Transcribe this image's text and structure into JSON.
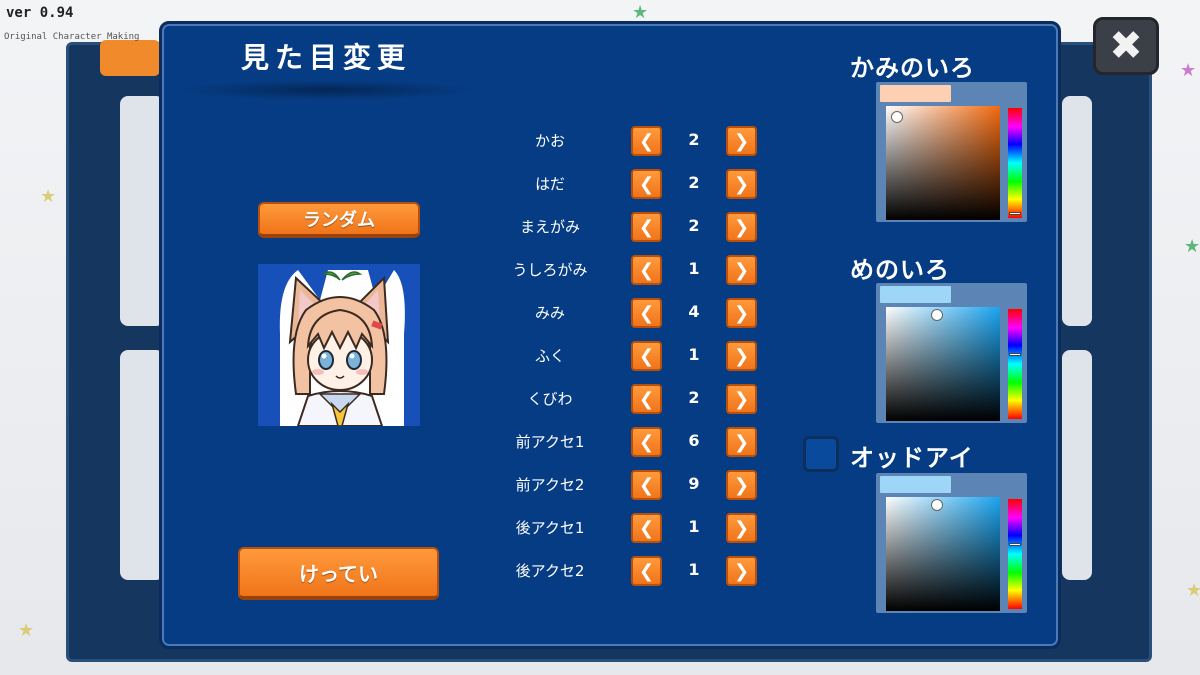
{
  "app": {
    "version": "ver 0.94",
    "subtitle": "Original Character Making"
  },
  "dialog": {
    "title": "見た目変更",
    "random_label": "ランダム",
    "confirm_label": "けってい"
  },
  "parts": [
    {
      "label": "かお",
      "value": "2"
    },
    {
      "label": "はだ",
      "value": "2"
    },
    {
      "label": "まえがみ",
      "value": "2"
    },
    {
      "label": "うしろがみ",
      "value": "1"
    },
    {
      "label": "みみ",
      "value": "4"
    },
    {
      "label": "ふく",
      "value": "1"
    },
    {
      "label": "くびわ",
      "value": "2"
    },
    {
      "label": "前アクセ1",
      "value": "6"
    },
    {
      "label": "前アクセ2",
      "value": "9"
    },
    {
      "label": "後アクセ1",
      "value": "1"
    },
    {
      "label": "後アクセ2",
      "value": "1"
    }
  ],
  "colors": {
    "hair": {
      "title": "かみのいろ",
      "swatch": "#fdd0b4",
      "hue_color": "#f26a10",
      "saturation": 0.1,
      "brightness": 0.9,
      "hue_position": 0.96
    },
    "eye": {
      "title": "めのいろ",
      "swatch": "#9ed6f7",
      "hue_color": "#1aa4f0",
      "saturation": 0.45,
      "brightness": 0.93,
      "hue_position": 0.42
    },
    "odd_eye": {
      "title": "オッドアイ",
      "checked": false,
      "swatch": "#9ed6f7",
      "hue_color": "#1aa4f0",
      "saturation": 0.45,
      "brightness": 0.93,
      "hue_position": 0.42
    }
  },
  "icons": {
    "close": "close-x-icon",
    "prev": "chevron-left-icon",
    "next": "chevron-right-icon"
  }
}
